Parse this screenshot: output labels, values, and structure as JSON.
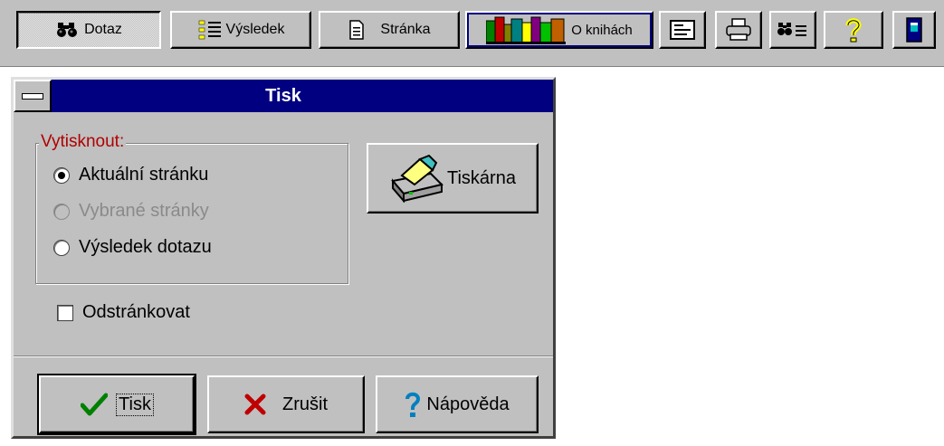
{
  "toolbar": {
    "dotaz": {
      "label": "Dotaz",
      "icon": "binoculars-icon"
    },
    "vysledek": {
      "label": "Výsledek",
      "icon": "list-icon"
    },
    "stranka": {
      "label": "Stránka",
      "icon": "page-icon"
    },
    "o_knihach": {
      "label": "O knihách",
      "icon": "books-icon"
    },
    "icons": [
      "card-icon",
      "printer-icon",
      "search-list-icon",
      "help-icon",
      "door-icon"
    ]
  },
  "dialog": {
    "title": "Tisk",
    "group_label": "Vytisknout:",
    "options": [
      {
        "label": "Aktuální stránku",
        "selected": true,
        "enabled": true
      },
      {
        "label": "Vybrané stránky",
        "selected": false,
        "enabled": false
      },
      {
        "label": "Výsledek dotazu",
        "selected": false,
        "enabled": true
      }
    ],
    "printer_button": "Tiskárna",
    "checkbox": {
      "label": "Odstránkovat",
      "checked": false
    },
    "buttons": {
      "ok": "Tisk",
      "cancel": "Zrušit",
      "help": "Nápověda"
    }
  },
  "colors": {
    "face": "#c0c0c0",
    "titlebar": "#000080",
    "group_label": "#b00000",
    "ok_check": "#008000",
    "cancel_x": "#c00000",
    "help_mark": "#0080c0"
  }
}
